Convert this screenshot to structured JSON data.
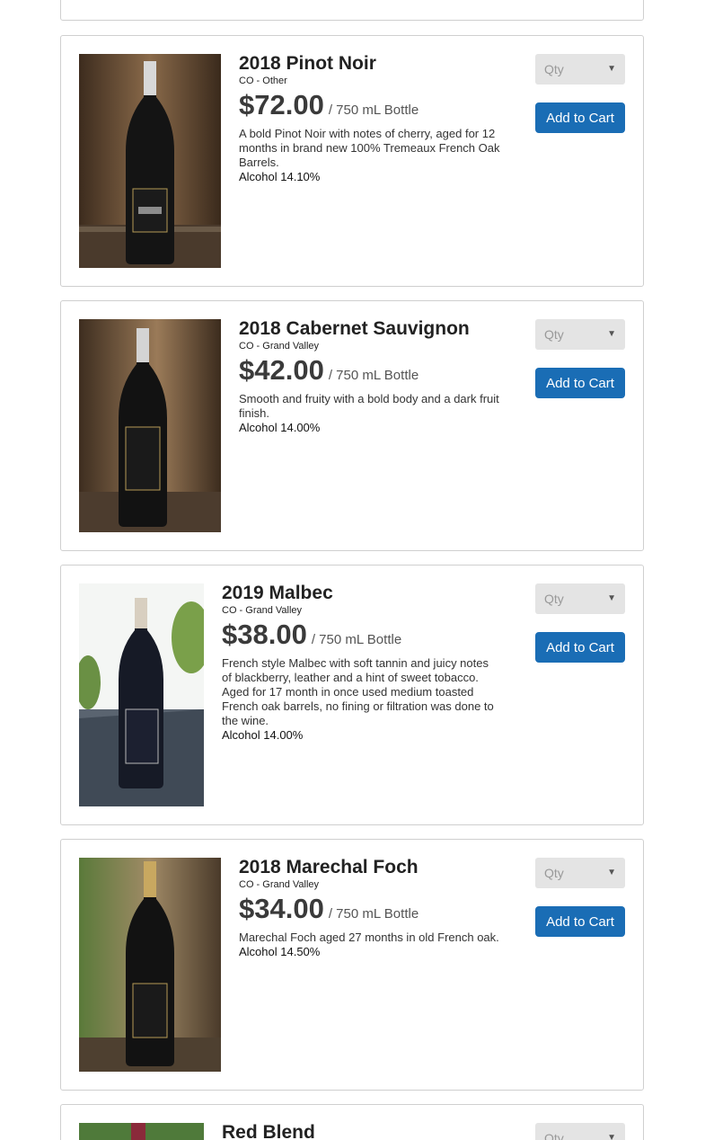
{
  "products": [
    {
      "name": "2018 Pinot Noir",
      "region": "CO - Other",
      "price": "$72.00",
      "unit": "/ 750 mL Bottle",
      "description": "A bold Pinot Noir with notes of cherry, aged for 12 months in brand new 100% Tremeaux French Oak Barrels.",
      "alcohol": "Alcohol 14.10%"
    },
    {
      "name": "2018 Cabernet Sauvignon",
      "region": "CO - Grand Valley",
      "price": "$42.00",
      "unit": "/ 750 mL Bottle",
      "description": "Smooth and fruity with a bold body and a dark fruit finish.",
      "alcohol": "Alcohol 14.00%"
    },
    {
      "name": "2019 Malbec",
      "region": "CO - Grand Valley",
      "price": "$38.00",
      "unit": "/ 750 mL Bottle",
      "description": "French style Malbec with soft tannin and juicy notes of blackberry, leather and a hint of sweet tobacco. Aged for 17 month in once used medium toasted French oak barrels, no fining or filtration was done to the wine.",
      "alcohol": "Alcohol 14.00%"
    },
    {
      "name": "2018 Marechal Foch",
      "region": "CO - Grand Valley",
      "price": "$34.00",
      "unit": "/ 750 mL Bottle",
      "description": "Marechal Foch aged 27 months in old French oak.",
      "alcohol": "Alcohol 14.50%"
    },
    {
      "name": "Red Blend"
    }
  ],
  "controls": {
    "qty_placeholder": "Qty",
    "add_to_cart_label": "Add to Cart"
  },
  "colors": {
    "button_blue": "#1a6db5",
    "qty_gray": "#e4e4e4",
    "card_border": "#cfcfcf"
  }
}
